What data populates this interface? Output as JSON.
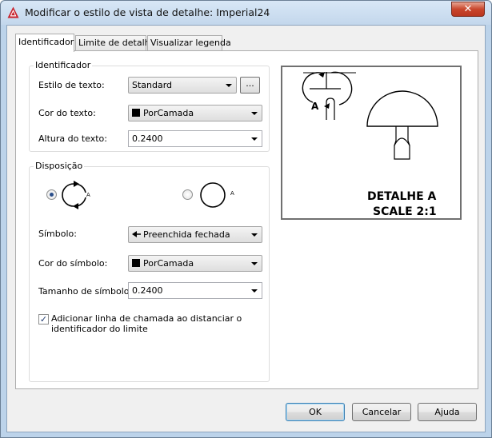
{
  "window": {
    "title": "Modificar o estilo de vista de detalhe: Imperial24",
    "close_glyph": "✕"
  },
  "tabs": [
    {
      "label": "Identificador",
      "active": true
    },
    {
      "label": "Limite de detalhe",
      "active": false
    },
    {
      "label": "Visualizar legenda",
      "active": false
    }
  ],
  "identifier_group": {
    "title": "Identificador",
    "text_style_label": "Estilo de texto:",
    "text_style_value": "Standard",
    "browse_label": "...",
    "text_color_label": "Cor do texto:",
    "text_color_value": "PorCamada",
    "text_height_label": "Altura do texto:",
    "text_height_value": "0.2400"
  },
  "arrangement_group": {
    "title": "Disposição",
    "option1_letter": "A",
    "option2_letter": "A",
    "selected_option": 1,
    "symbol_label": "Símbolo:",
    "symbol_value": "Preenchida fechada",
    "symbol_color_label": "Cor do símbolo:",
    "symbol_color_value": "PorCamada",
    "symbol_size_label": "Tamanho de símbolo:",
    "symbol_size_value": "0.2400",
    "leader_checkbox_label_line1": "Adicionar linha de chamada ao distanciar o",
    "leader_checkbox_label_line2": "identificador do limite",
    "leader_checkbox_checked": true
  },
  "preview": {
    "identifier_letter": "A",
    "caption_line1": "DETALHE A",
    "caption_line2": "SCALE 2:1"
  },
  "buttons": {
    "ok": "OK",
    "cancel": "Cancelar",
    "help": "Ajuda"
  },
  "colors": {
    "titlebar": "#c8dbef",
    "close_button": "#c9462c",
    "accent": "#3c7fb1"
  }
}
